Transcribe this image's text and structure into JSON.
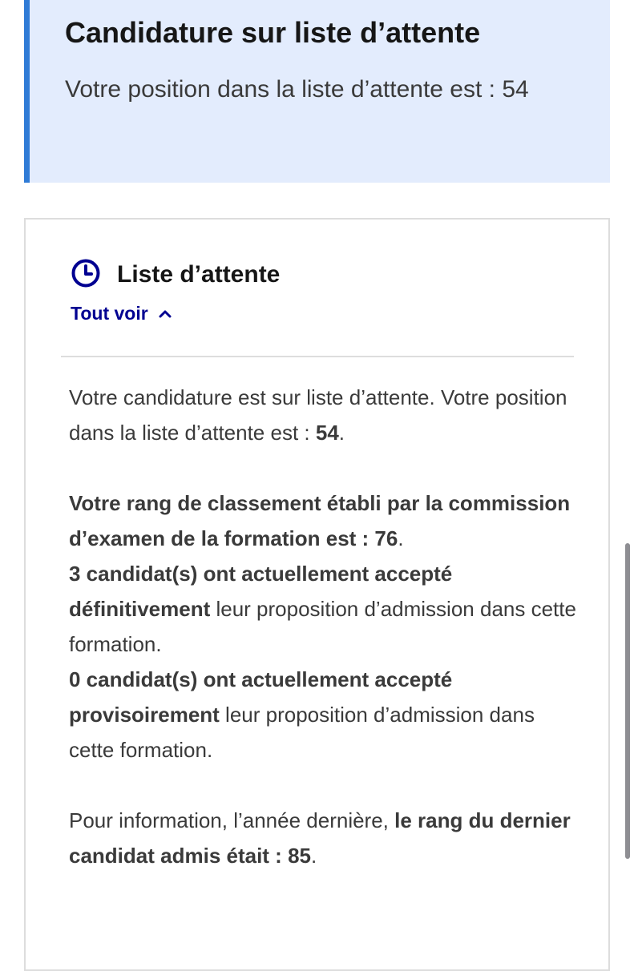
{
  "notice": {
    "title": "Candidature sur liste d’attente",
    "text": "Votre position dans la liste d’attente est : 54"
  },
  "panel": {
    "title": "Liste d’attente",
    "icon": "clock-icon",
    "toggle_label": "Tout voir",
    "toggle_icon": "chevron-up-icon",
    "accent_color": "#000091",
    "para1_text": "Votre candidature est sur liste d’attente. Votre position dans la liste d’attente est : ",
    "para1_position": "54",
    "para1_end": ".",
    "rank_label": "Votre rang de classement établi par la commission d’examen de la formation est : 76",
    "rank_end": ".",
    "definitive_bold": "3 candidat(s) ont actuellement accepté définitivement",
    "definitive_rest": " leur proposition d’admission dans cette formation.",
    "provisional_bold": "0 candidat(s) ont actuellement accepté provisoirement",
    "provisional_rest": " leur proposition d’admission dans cette formation.",
    "info_text": "Pour information, l’année dernière, ",
    "info_bold": "le rang du dernier candidat admis était : 85",
    "info_end": "."
  }
}
